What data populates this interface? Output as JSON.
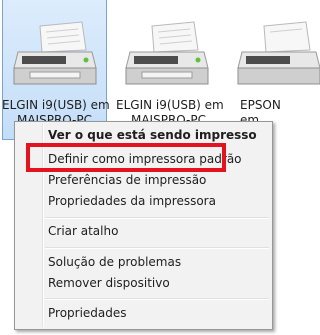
{
  "devices": [
    {
      "label_line1": "ELGIN i9(USB) em",
      "label_line2": "MAISPRO-PC",
      "selected": true
    },
    {
      "label_line1": "ELGIN i9(USB) em",
      "label_line2": "MAISPRO-PC",
      "selected": false
    },
    {
      "label_line1": "EPSON",
      "label_line2": "em",
      "selected": false
    }
  ],
  "context_menu": {
    "items": [
      {
        "label": "Ver o que está sendo impresso",
        "bold": true
      },
      {
        "label": "Definir como impressora padrão",
        "bold": false
      },
      {
        "label": "Preferências de impressão",
        "bold": false
      },
      {
        "label": "Propriedades da impressora",
        "bold": false
      },
      {
        "label": "Criar atalho",
        "bold": false
      },
      {
        "label": "Solução de problemas",
        "bold": false
      },
      {
        "label": "Remover dispositivo",
        "bold": false
      },
      {
        "label": "Propriedades",
        "bold": false
      }
    ]
  },
  "colors": {
    "highlight_box": "#e3141e",
    "selection_bg": "#cfe5fb",
    "menu_bg": "#f2f2f2"
  }
}
